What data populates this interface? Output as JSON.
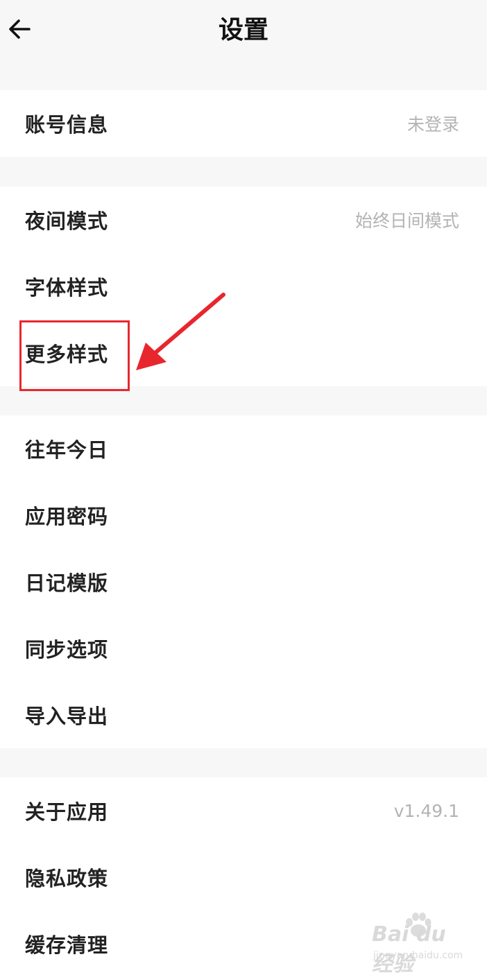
{
  "header": {
    "title": "设置"
  },
  "sections": [
    {
      "items": [
        {
          "label": "账号信息",
          "value": "未登录"
        }
      ]
    },
    {
      "items": [
        {
          "label": "夜间模式",
          "value": "始终日间模式"
        },
        {
          "label": "字体样式",
          "value": ""
        },
        {
          "label": "更多样式",
          "value": ""
        }
      ]
    },
    {
      "items": [
        {
          "label": "往年今日",
          "value": ""
        },
        {
          "label": "应用密码",
          "value": ""
        },
        {
          "label": "日记模版",
          "value": ""
        },
        {
          "label": "同步选项",
          "value": ""
        },
        {
          "label": "导入导出",
          "value": ""
        }
      ]
    },
    {
      "items": [
        {
          "label": "关于应用",
          "value": "v1.49.1"
        },
        {
          "label": "隐私政策",
          "value": ""
        },
        {
          "label": "缓存清理",
          "value": ""
        }
      ]
    }
  ],
  "annotation": {
    "color": "#e8262d"
  },
  "watermark": {
    "main": "Bai du 经验",
    "sub": "jingyan.baidu.com"
  }
}
